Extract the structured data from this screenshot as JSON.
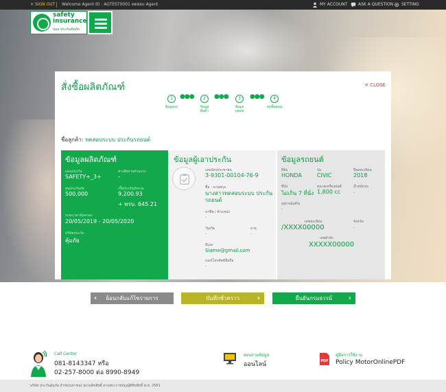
{
  "topbar": {
    "signout": "SIGN OUT",
    "welcome": "Welcome Agent ID : AGTEST0001 ทดสอบ Agent",
    "my_account": "MY ACCOUNT",
    "ask": "ASK A QUESTION",
    "setting": "SETTING"
  },
  "logo": {
    "brand_line1": "safety",
    "brand_line2": "insurance",
    "sub": "บมจ.ประกันคุ้มภัย"
  },
  "card": {
    "title": "สั่งซื้อผลิตภัณฑ์",
    "close": "CLOSE",
    "steps": [
      {
        "num": "1",
        "label1": "ข้อมูลรถ",
        "label2": ""
      },
      {
        "num": "2",
        "label1": "ข้อมูล",
        "label2": "สินค้า"
      },
      {
        "num": "3",
        "label1": "ข้อมูล",
        "label2": "บุคคล"
      },
      {
        "num": "4",
        "label1": "จบขั้นตอน",
        "label2": ""
      }
    ],
    "customer_label": "ชื่อลูกค้า:",
    "customer_value": "ทดสอบระบบ ประกันรถยนต์"
  },
  "product": {
    "heading": "ข้อมูลผลิตภัณฑ์",
    "plan_label": "แผนประกัน",
    "plan_value": "SAFETY+_3+",
    "deduct_label": "ค่าเสียหายส่วนแรก",
    "deduct_value": "-",
    "sum_label": "ทุนประกันภัย",
    "sum_value": "500,000",
    "premium_label": "เบี้ยประกันภัยรวม",
    "premium_value": "9,200.93",
    "compulsory_value": "+ พรบ. 645.21",
    "period_label": "ระยะเวลาคุ้มครอง",
    "period_value": "20/05/2019 - 20/05/2020",
    "company_label": "บริษัทประกัน",
    "company_value": "คุ้มภัย"
  },
  "insured": {
    "heading": "ข้อมูลผู้เอาประกัน",
    "id_label": "เลขบัตรประชาชน",
    "id_value": "3-9301-00104-76-9",
    "name_label": "ชื่อ - นามสกุล",
    "name_value": "นางสาวทดสอบระบบ ประกันรถยนต์",
    "job_label": "อาชีพ / ตำแหน่ง",
    "job_value": "-",
    "birth_label": "วันเกิด",
    "birth_value": "-",
    "age_label": "อายุ",
    "age_value": "-",
    "email_label": "อีเมล",
    "email_value": "Siame@gmail.com",
    "phone_label": "เบอร์โทรศัพท์มือถือ",
    "phone_value": "-"
  },
  "vehicle": {
    "heading": "ข้อมูลรถยนต์",
    "brand_label": "ยี่ห้อ",
    "brand_value": "HONDA",
    "model_label": "รุ่น",
    "model_value": "CIVIC",
    "year_label": "ปีจดทะเบียน",
    "year_value": "2018",
    "seats_label": "ที่นั่ง",
    "seats_value": "ไม่เกิน 7 ที่นั่ง",
    "cc_label": "ขนาดเครื่องยนต์",
    "cc_value": "1,800 cc",
    "weight_label": "น้ำหนักรถ",
    "weight_value": "-",
    "equip_label": "อุปกรณ์เสริม",
    "equip_value": "-",
    "plate_label": "เลขทะเบียน",
    "plate_value": "/XXXX00000",
    "province_label": "จังหวัด",
    "province_value": "-",
    "chassis_label": "เลขตัวถัง",
    "chassis_value": "XXXXX00000"
  },
  "buttons": {
    "back": "ย้อนกลับแก้ไขรายการ",
    "save": "บันทึกชั่วคราว",
    "confirm": "ยืนยันกรมธรรม์"
  },
  "footer": {
    "cc_label": "Call Center",
    "cc_line1": "081-8143347 หรือ",
    "cc_line2": "02-257-8000 ต่อ 8990-8949",
    "online_label": "สอบถามข้อมูล",
    "online_text": "ออนไลน์",
    "pdf_label": "คู่มือการใช้งาน",
    "pdf_text": "Policy MotorOnlinePDF",
    "copyright": "บริษัท ประกันคุ้มภัย จำกัด(มหาชน) สงวนลิขสิทธิ์ ตามพระราชบัญญัติลิขสิทธิ์ พ.ศ. 2561"
  },
  "colors": {
    "green": "#12a84c",
    "olive": "#b7b426",
    "gray": "#8a8a8a",
    "red": "#e53935"
  }
}
